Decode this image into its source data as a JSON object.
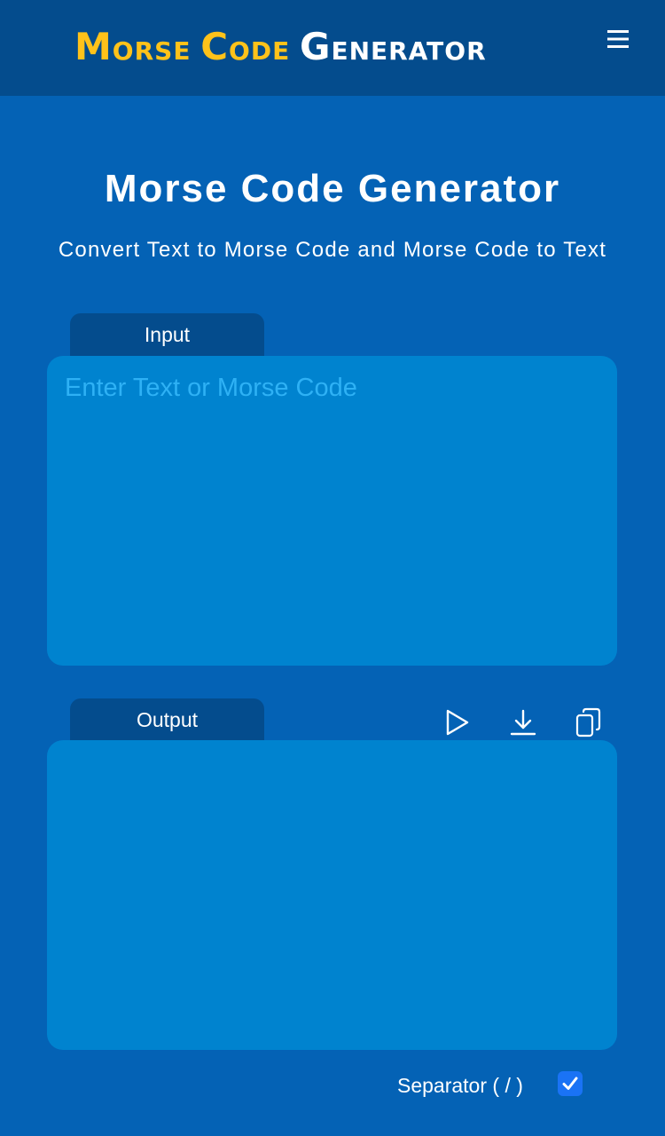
{
  "header": {
    "logo": {
      "word1_initial": "M",
      "word1_rest": "ORSE",
      "word2_initial": "C",
      "word2_rest": "ODE",
      "word3_initial": "G",
      "word3_rest": "ENERATOR"
    },
    "menu_icon": "hamburger-menu-icon"
  },
  "main": {
    "title": "Morse Code Generator",
    "subtitle": "Convert Text to Morse Code and Morse Code to Text"
  },
  "input": {
    "tab_label": "Input",
    "placeholder": "Enter Text or Morse Code",
    "value": ""
  },
  "output": {
    "tab_label": "Output",
    "value": "",
    "actions": [
      "play-icon",
      "download-icon",
      "copy-icon"
    ]
  },
  "separator": {
    "label": "Separator ( / )",
    "checked": true
  },
  "colors": {
    "page_background": "#0462b5",
    "header_background": "#044c8d",
    "box_background": "#0083cf",
    "logo_yellow": "#ffc21a",
    "placeholder": "#2eb1f5",
    "checkbox": "#1a73f5"
  }
}
